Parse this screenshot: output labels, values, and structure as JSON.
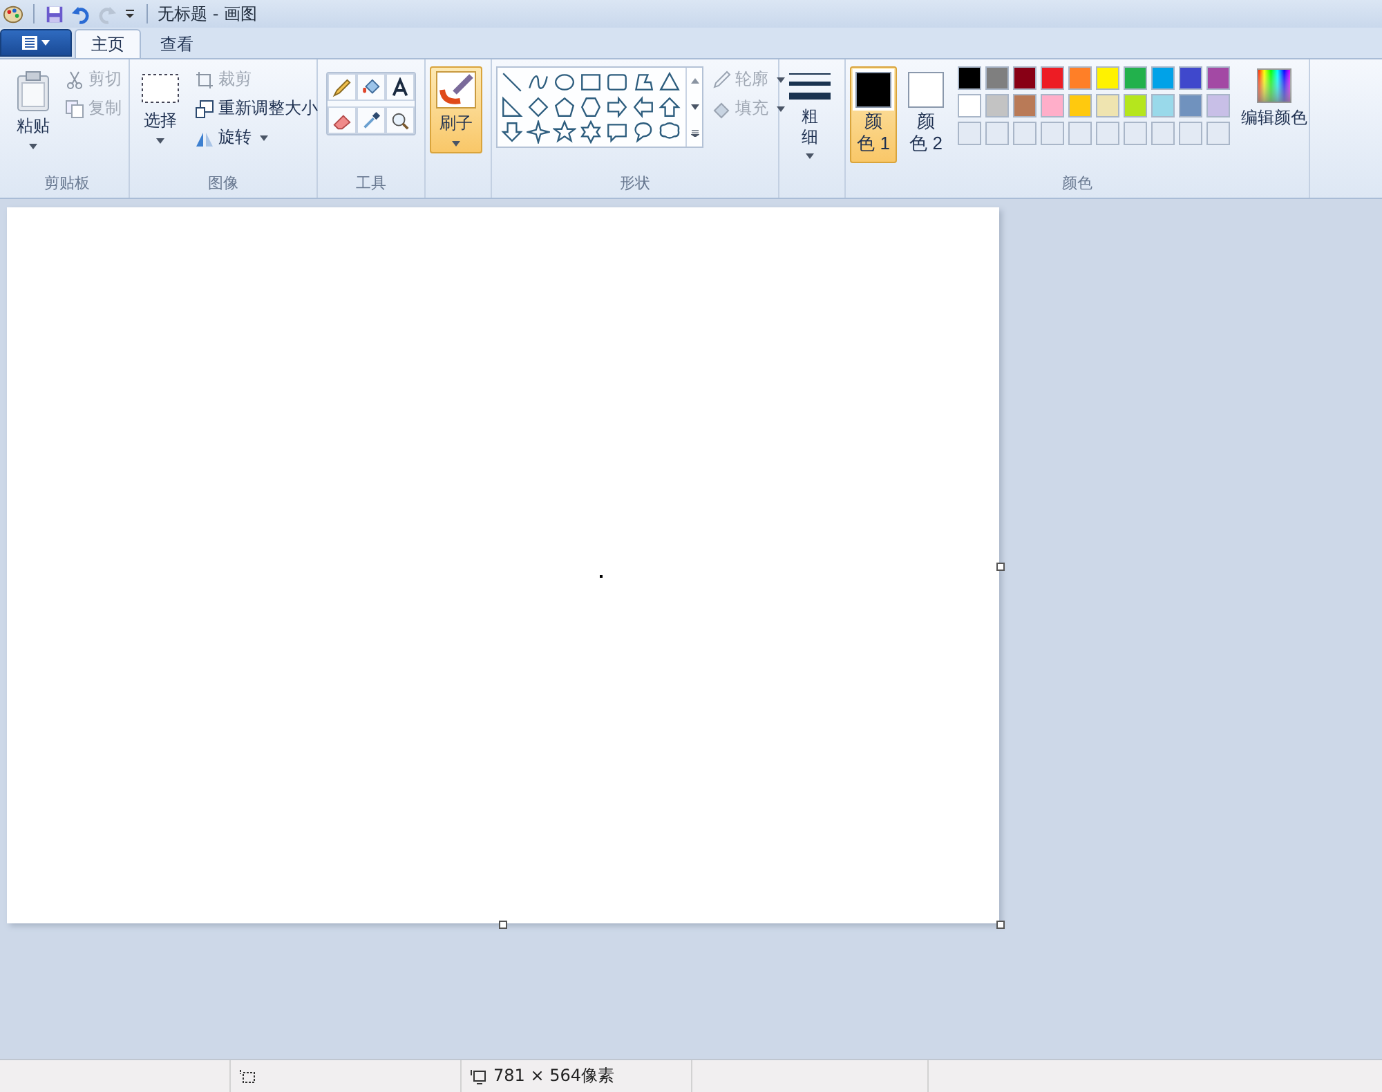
{
  "window": {
    "title": "无标题 - 画图"
  },
  "tabs": [
    {
      "label": "主页",
      "selected": true
    },
    {
      "label": "查看",
      "selected": false
    }
  ],
  "clipboard": {
    "paste": "粘贴",
    "cut": {
      "label": "剪切",
      "disabled": true
    },
    "copy": {
      "label": "复制",
      "disabled": true
    },
    "group_label": "剪贴板"
  },
  "image": {
    "select": "选择",
    "crop": {
      "label": "裁剪",
      "disabled": true
    },
    "resize": {
      "label": "重新调整大小",
      "disabled": false
    },
    "rotate": {
      "label": "旋转",
      "disabled": false
    },
    "group_label": "图像"
  },
  "tools": {
    "group_label": "工具"
  },
  "brush": {
    "label": "刷子",
    "selected": true
  },
  "shapes": {
    "outline": {
      "label": "轮廓",
      "disabled": true
    },
    "fill": {
      "label": "填充",
      "disabled": true
    },
    "group_label": "形状"
  },
  "size": {
    "label": "粗细"
  },
  "colors": {
    "color1": {
      "label": "颜色 1",
      "color": "#000000",
      "selected": true
    },
    "color2": {
      "label": "颜色 2",
      "color": "#ffffff",
      "selected": false
    },
    "palette": [
      {
        "color": "#000000"
      },
      {
        "color": "#7f7f7f"
      },
      {
        "color": "#880015"
      },
      {
        "color": "#ed1c24"
      },
      {
        "color": "#ff7f27"
      },
      {
        "color": "#fff200"
      },
      {
        "color": "#22b14c"
      },
      {
        "color": "#00a2e8"
      },
      {
        "color": "#3f48cc"
      },
      {
        "color": "#a349a4"
      },
      {
        "color": "#ffffff"
      },
      {
        "color": "#c3c3c3"
      },
      {
        "color": "#b97a57"
      },
      {
        "color": "#ffaec9"
      },
      {
        "color": "#ffc90e"
      },
      {
        "color": "#efe4b0"
      },
      {
        "color": "#b5e61d"
      },
      {
        "color": "#99d9ea"
      },
      {
        "color": "#7092be"
      },
      {
        "color": "#c8bfe7"
      }
    ],
    "edit": "编辑颜色",
    "group_label": "颜色"
  },
  "status_bar": {
    "canvas_size": "781 × 564像素"
  }
}
